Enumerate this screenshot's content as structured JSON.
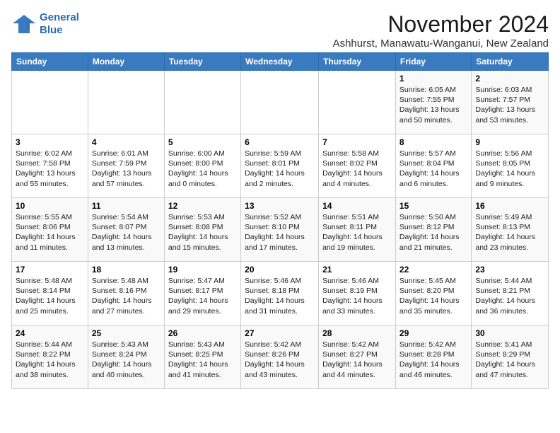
{
  "logo": {
    "line1": "General",
    "line2": "Blue"
  },
  "title": "November 2024",
  "subtitle": "Ashhurst, Manawatu-Wanganui, New Zealand",
  "days_header": [
    "Sunday",
    "Monday",
    "Tuesday",
    "Wednesday",
    "Thursday",
    "Friday",
    "Saturday"
  ],
  "weeks": [
    [
      {
        "day": "",
        "info": ""
      },
      {
        "day": "",
        "info": ""
      },
      {
        "day": "",
        "info": ""
      },
      {
        "day": "",
        "info": ""
      },
      {
        "day": "",
        "info": ""
      },
      {
        "day": "1",
        "info": "Sunrise: 6:05 AM\nSunset: 7:55 PM\nDaylight: 13 hours and 50 minutes."
      },
      {
        "day": "2",
        "info": "Sunrise: 6:03 AM\nSunset: 7:57 PM\nDaylight: 13 hours and 53 minutes."
      }
    ],
    [
      {
        "day": "3",
        "info": "Sunrise: 6:02 AM\nSunset: 7:58 PM\nDaylight: 13 hours and 55 minutes."
      },
      {
        "day": "4",
        "info": "Sunrise: 6:01 AM\nSunset: 7:59 PM\nDaylight: 13 hours and 57 minutes."
      },
      {
        "day": "5",
        "info": "Sunrise: 6:00 AM\nSunset: 8:00 PM\nDaylight: 14 hours and 0 minutes."
      },
      {
        "day": "6",
        "info": "Sunrise: 5:59 AM\nSunset: 8:01 PM\nDaylight: 14 hours and 2 minutes."
      },
      {
        "day": "7",
        "info": "Sunrise: 5:58 AM\nSunset: 8:02 PM\nDaylight: 14 hours and 4 minutes."
      },
      {
        "day": "8",
        "info": "Sunrise: 5:57 AM\nSunset: 8:04 PM\nDaylight: 14 hours and 6 minutes."
      },
      {
        "day": "9",
        "info": "Sunrise: 5:56 AM\nSunset: 8:05 PM\nDaylight: 14 hours and 9 minutes."
      }
    ],
    [
      {
        "day": "10",
        "info": "Sunrise: 5:55 AM\nSunset: 8:06 PM\nDaylight: 14 hours and 11 minutes."
      },
      {
        "day": "11",
        "info": "Sunrise: 5:54 AM\nSunset: 8:07 PM\nDaylight: 14 hours and 13 minutes."
      },
      {
        "day": "12",
        "info": "Sunrise: 5:53 AM\nSunset: 8:08 PM\nDaylight: 14 hours and 15 minutes."
      },
      {
        "day": "13",
        "info": "Sunrise: 5:52 AM\nSunset: 8:10 PM\nDaylight: 14 hours and 17 minutes."
      },
      {
        "day": "14",
        "info": "Sunrise: 5:51 AM\nSunset: 8:11 PM\nDaylight: 14 hours and 19 minutes."
      },
      {
        "day": "15",
        "info": "Sunrise: 5:50 AM\nSunset: 8:12 PM\nDaylight: 14 hours and 21 minutes."
      },
      {
        "day": "16",
        "info": "Sunrise: 5:49 AM\nSunset: 8:13 PM\nDaylight: 14 hours and 23 minutes."
      }
    ],
    [
      {
        "day": "17",
        "info": "Sunrise: 5:48 AM\nSunset: 8:14 PM\nDaylight: 14 hours and 25 minutes."
      },
      {
        "day": "18",
        "info": "Sunrise: 5:48 AM\nSunset: 8:16 PM\nDaylight: 14 hours and 27 minutes."
      },
      {
        "day": "19",
        "info": "Sunrise: 5:47 AM\nSunset: 8:17 PM\nDaylight: 14 hours and 29 minutes."
      },
      {
        "day": "20",
        "info": "Sunrise: 5:46 AM\nSunset: 8:18 PM\nDaylight: 14 hours and 31 minutes."
      },
      {
        "day": "21",
        "info": "Sunrise: 5:46 AM\nSunset: 8:19 PM\nDaylight: 14 hours and 33 minutes."
      },
      {
        "day": "22",
        "info": "Sunrise: 5:45 AM\nSunset: 8:20 PM\nDaylight: 14 hours and 35 minutes."
      },
      {
        "day": "23",
        "info": "Sunrise: 5:44 AM\nSunset: 8:21 PM\nDaylight: 14 hours and 36 minutes."
      }
    ],
    [
      {
        "day": "24",
        "info": "Sunrise: 5:44 AM\nSunset: 8:22 PM\nDaylight: 14 hours and 38 minutes."
      },
      {
        "day": "25",
        "info": "Sunrise: 5:43 AM\nSunset: 8:24 PM\nDaylight: 14 hours and 40 minutes."
      },
      {
        "day": "26",
        "info": "Sunrise: 5:43 AM\nSunset: 8:25 PM\nDaylight: 14 hours and 41 minutes."
      },
      {
        "day": "27",
        "info": "Sunrise: 5:42 AM\nSunset: 8:26 PM\nDaylight: 14 hours and 43 minutes."
      },
      {
        "day": "28",
        "info": "Sunrise: 5:42 AM\nSunset: 8:27 PM\nDaylight: 14 hours and 44 minutes."
      },
      {
        "day": "29",
        "info": "Sunrise: 5:42 AM\nSunset: 8:28 PM\nDaylight: 14 hours and 46 minutes."
      },
      {
        "day": "30",
        "info": "Sunrise: 5:41 AM\nSunset: 8:29 PM\nDaylight: 14 hours and 47 minutes."
      }
    ]
  ]
}
